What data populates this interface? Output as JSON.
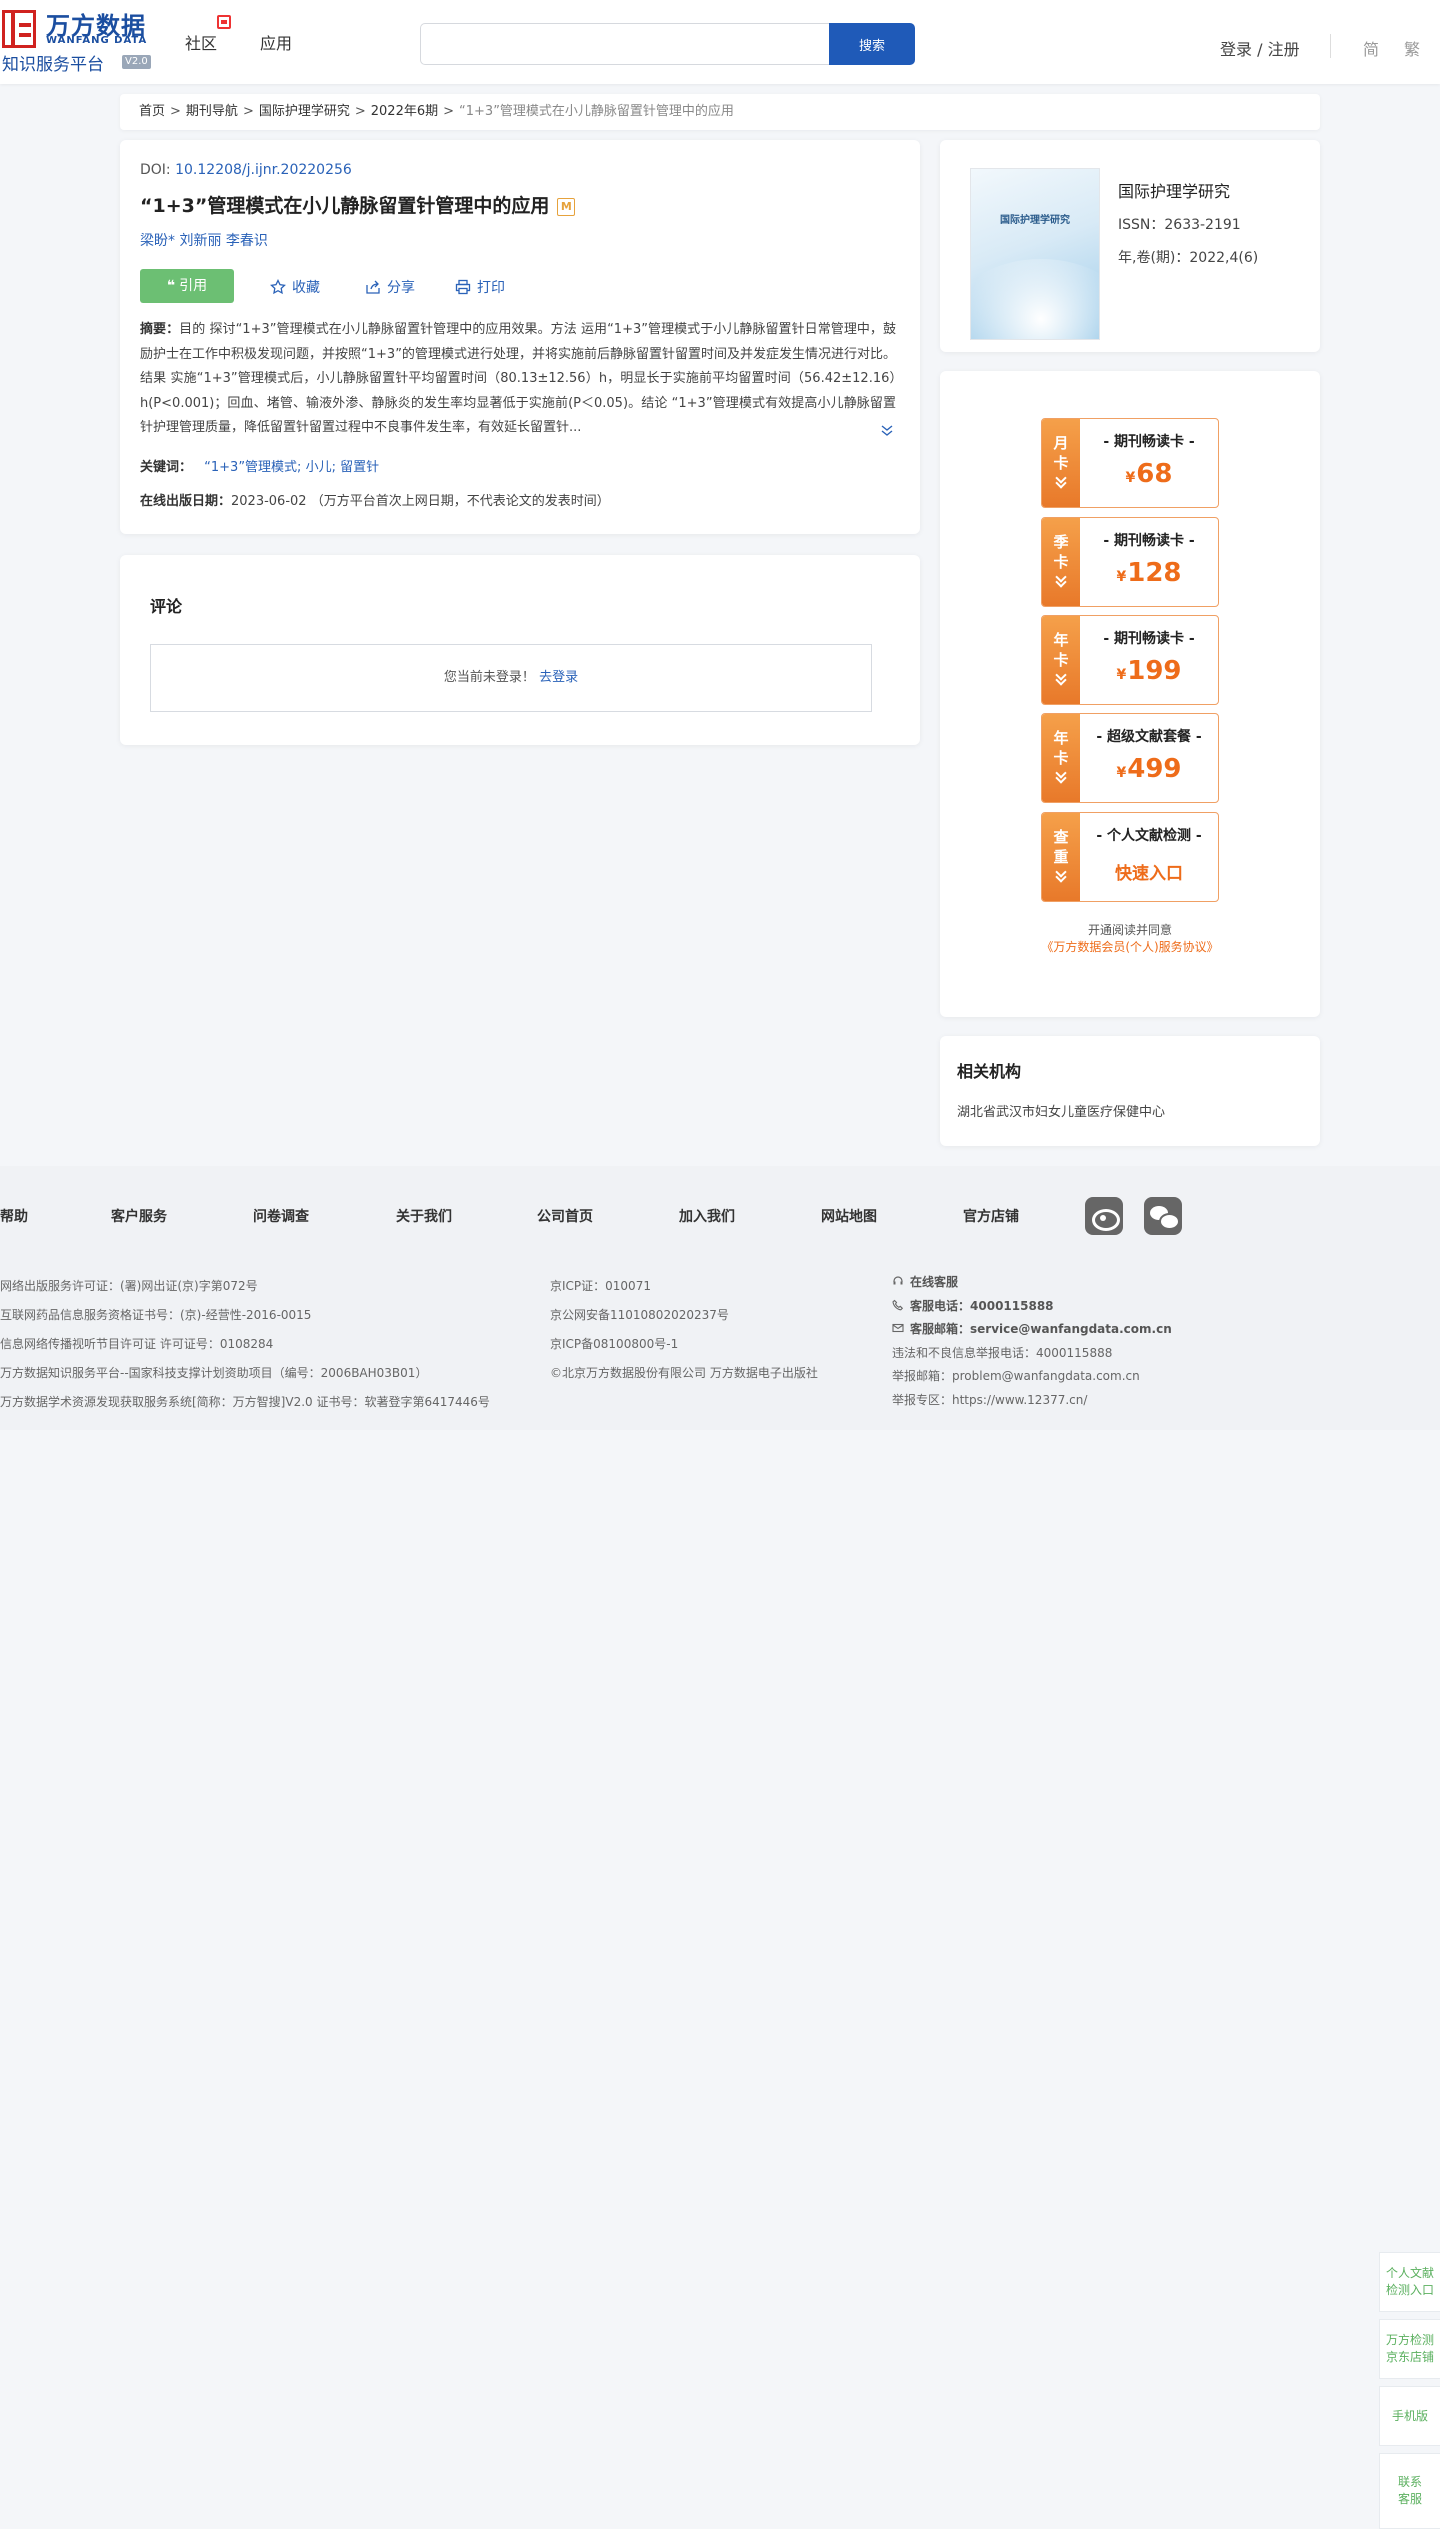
{
  "header": {
    "logo": {
      "cn": "万方数据",
      "en": "WANFANG DATA",
      "sub": "知识服务平台",
      "version": "V2.0"
    },
    "nav": [
      "社区",
      "应用"
    ],
    "search": {
      "placeholder": "",
      "button": "搜索"
    },
    "login": "登录 / 注册",
    "lang": [
      "简",
      "繁"
    ]
  },
  "breadcrumb": [
    "首页",
    "期刊导航",
    "国际护理学研究",
    "2022年6期",
    "“1+3”管理模式在小儿静脉留置针管理中的应用"
  ],
  "article": {
    "doi_label": "DOI:",
    "doi_value": "10.12208/j.ijnr.20220256",
    "title": "“1+3”管理模式在小儿静脉留置针管理中的应用",
    "badge": "M",
    "authors": [
      "梁盼*",
      "刘新丽",
      "李春识"
    ],
    "actions": {
      "cite": "引用",
      "favorite": "收藏",
      "share": "分享",
      "print": "打印"
    },
    "abstract_label": "摘要：",
    "abstract": "目的 探讨“1+3”管理模式在小儿静脉留置针管理中的应用效果。方法 运用“1+3”管理模式于小儿静脉留置针日常管理中，鼓励护士在工作中积极发现问题，并按照“1+3”的管理模式进行处理，并将实施前后静脉留置针留置时间及并发症发生情况进行对比。结果 实施“1+3”管理模式后，小儿静脉留置针平均留置时间（80.13±12.56）h，明显长于实施前平均留置时间（56.42±12.16）h(P<0.001)；回血、堵管、输液外渗、静脉炎的发生率均显著低于实施前(P＜0.05)。结论 “1+3”管理模式有效提高小儿静脉留置针护理管理质量，降低留置针留置过程中不良事件发生率，有效延长留置针...",
    "keywords_label": "关键词：",
    "keywords": "“1+3”管理模式; 小儿; 留置针",
    "date_label": "在线出版日期：",
    "date_value": "2023-06-02 （万方平台首次上网日期，不代表论文的发表时间）"
  },
  "comment": {
    "title": "评论",
    "not_logged": "您当前未登录！",
    "login_link": "去登录"
  },
  "journal": {
    "cover_title": "国际护理学研究",
    "name": "国际护理学研究",
    "issn": "ISSN：2633-2191",
    "issue": "年,卷(期)：2022,4(6)"
  },
  "offers": [
    {
      "side": [
        "月",
        "卡"
      ],
      "name": "- 期刊畅读卡 -",
      "currency": "¥",
      "price": "68"
    },
    {
      "side": [
        "季",
        "卡"
      ],
      "name": "- 期刊畅读卡 -",
      "currency": "¥",
      "price": "128"
    },
    {
      "side": [
        "年",
        "卡"
      ],
      "name": "- 期刊畅读卡 -",
      "currency": "¥",
      "price": "199"
    },
    {
      "side": [
        "年",
        "卡"
      ],
      "name": "- 超级文献套餐 -",
      "currency": "¥",
      "price": "499"
    },
    {
      "side": [
        "查",
        "重"
      ],
      "name": "- 个人文献检测 -",
      "link": "快速入口"
    }
  ],
  "agreement": {
    "line1": "开通阅读并同意",
    "line2": "《万方数据会员(个人)服务协议》"
  },
  "institution": {
    "title": "相关机构",
    "name": "湖北省武汉市妇女儿童医疗保健中心"
  },
  "footer": {
    "nav": [
      "帮助",
      "客户服务",
      "问卷调查",
      "关于我们",
      "公司首页",
      "加入我们",
      "网站地图",
      "官方店铺"
    ],
    "col1": [
      "网络出版服务许可证：(署)网出证(京)字第072号",
      "互联网药品信息服务资格证书号：(京)-经营性-2016-0015",
      "信息网络传播视听节目许可证 许可证号：0108284",
      "万方数据知识服务平台--国家科技支撑计划资助项目（编号：2006BAH03B01）",
      "万方数据学术资源发现获取服务系统[简称：万方智搜]V2.0 证书号：软著登字第6417446号"
    ],
    "col2": [
      "京ICP证：010071",
      "京公网安备11010802020237号",
      "京ICP备08100800号-1",
      "©北京万方数据股份有限公司 万方数据电子出版社"
    ],
    "col3": {
      "online": "在线客服",
      "phone_label": "客服电话：",
      "phone": "4000115888",
      "email_label": "客服邮箱：",
      "email": "service@wanfangdata.com.cn",
      "report_phone": "违法和不良信息举报电话：4000115888",
      "report_email": "举报邮箱：problem@wanfangdata.com.cn",
      "report_zone": "举报专区：https://www.12377.cn/"
    }
  },
  "float": [
    [
      "个人文献",
      "检测入口"
    ],
    [
      "万方检测",
      "京东店铺"
    ],
    [
      "手机版"
    ],
    [
      "联系",
      "客服"
    ]
  ]
}
